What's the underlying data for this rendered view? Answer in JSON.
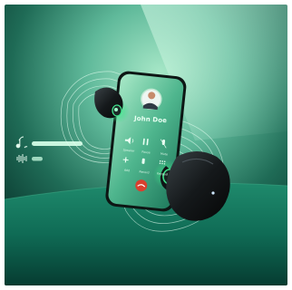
{
  "call": {
    "caller_name": "John Doe",
    "controls": [
      "Speaker",
      "Pause",
      "Mute",
      "Add",
      "Record",
      "Keypad"
    ]
  },
  "colors": {
    "background_dark": "#0c3a30",
    "background_light": "#9fe2c1",
    "accent_green": "#3fe08a",
    "earbud": "#15191b",
    "end_call_red": "#d8402f"
  },
  "audio_indicator": {
    "icons": [
      "music-note-icon",
      "waveform-icon"
    ],
    "levels": [
      0.9,
      0.2
    ]
  }
}
